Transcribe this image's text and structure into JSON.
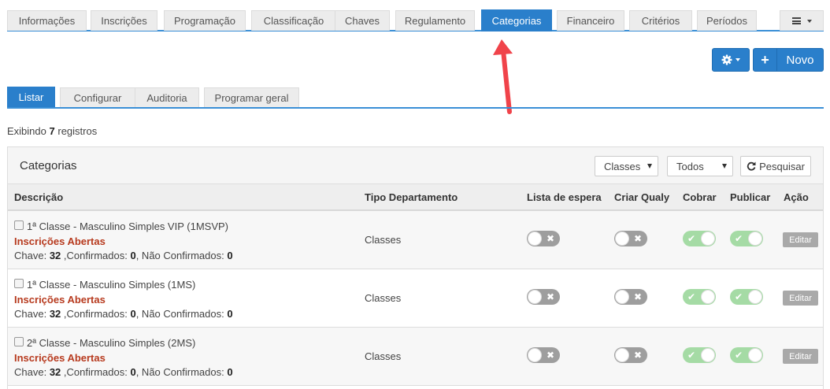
{
  "top_tabs": [
    {
      "label": "Informações",
      "active": false
    },
    {
      "label": "Inscrições",
      "active": false
    },
    {
      "label": "Programação",
      "active": false
    },
    {
      "label": "Classificação",
      "active": false
    },
    {
      "label": "Chaves",
      "active": false
    },
    {
      "label": "Regulamento",
      "active": false
    },
    {
      "label": "Categorias",
      "active": true
    },
    {
      "label": "Financeiro",
      "active": false
    },
    {
      "label": "Critérios",
      "active": false
    },
    {
      "label": "Períodos",
      "active": false
    }
  ],
  "actions": {
    "new_label": "Novo"
  },
  "sub_tabs": [
    {
      "label": "Listar",
      "active": true
    },
    {
      "label": "Configurar",
      "active": false
    },
    {
      "label": "Auditoria",
      "active": false
    },
    {
      "label": "Programar geral",
      "active": false
    }
  ],
  "records": {
    "prefix": "Exibindo",
    "count": "7",
    "suffix": "registros"
  },
  "panel": {
    "title": "Categorias",
    "filter_type": "Classes",
    "filter_status": "Todos",
    "search_label": "Pesquisar"
  },
  "table": {
    "headers": {
      "descricao": "Descrição",
      "tipo": "Tipo Departamento",
      "lista": "Lista de espera",
      "qualy": "Criar Qualy",
      "cobrar": "Cobrar",
      "publicar": "Publicar",
      "acao": "Ação"
    },
    "labels": {
      "chave": "Chave:",
      "confirmados": ",Confirmados:",
      "nao_confirmados": ", Não Confirmados:"
    },
    "edit_label": "Editar",
    "rows": [
      {
        "name": "1ª Classe - Masculino Simples VIP (1MSVP)",
        "status": "Inscrições Abertas",
        "chave": "32",
        "confirmados": "0",
        "nao_confirmados": "0",
        "tipo": "Classes",
        "lista_espera": false,
        "criar_qualy": false,
        "cobrar": true,
        "publicar": true
      },
      {
        "name": "1ª Classe - Masculino Simples (1MS)",
        "status": "Inscrições Abertas",
        "chave": "32",
        "confirmados": "0",
        "nao_confirmados": "0",
        "tipo": "Classes",
        "lista_espera": false,
        "criar_qualy": false,
        "cobrar": true,
        "publicar": true
      },
      {
        "name": "2ª Classe - Masculino Simples (2MS)",
        "status": "Inscrições Abertas",
        "chave": "32",
        "confirmados": "0",
        "nao_confirmados": "0",
        "tipo": "Classes",
        "lista_espera": false,
        "criar_qualy": false,
        "cobrar": true,
        "publicar": true
      }
    ]
  }
}
